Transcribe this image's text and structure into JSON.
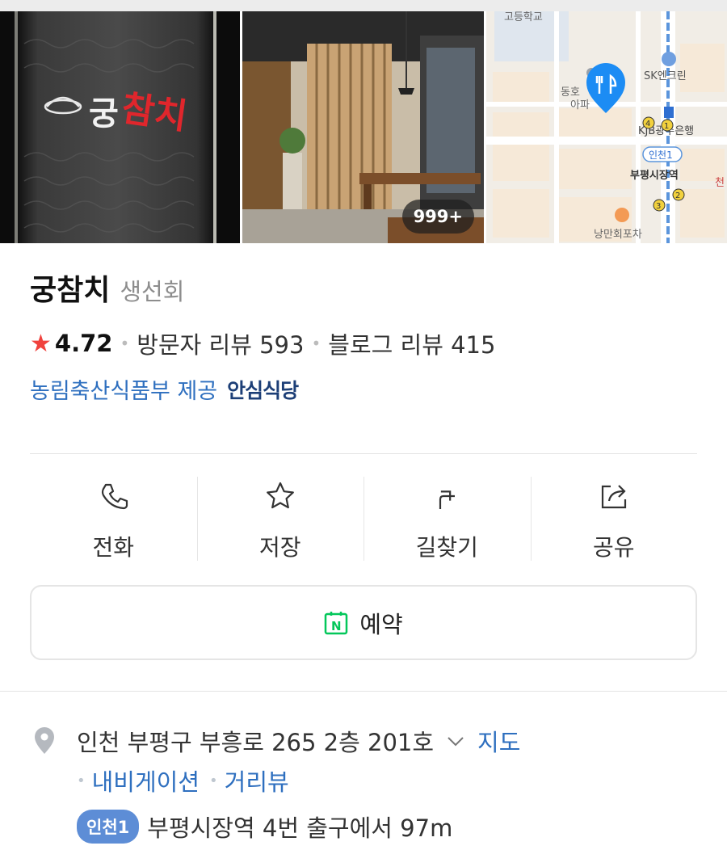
{
  "photos": {
    "count_badge": "999+",
    "logo_text": "궁참치"
  },
  "map": {
    "labels": {
      "school": "고등학교",
      "apartment": "동호",
      "apartment_suffix": "아파",
      "cleaner": "SK엔크린",
      "bank": "KJB광주은행",
      "station_badge": "인천1",
      "station_name": "부평시장역",
      "restaurant": "낭만회포차",
      "edge_label": "천"
    },
    "exit_numbers": [
      "4",
      "1",
      "2",
      "3"
    ]
  },
  "place": {
    "name": "궁참치",
    "category": "생선회",
    "rating": "4.72",
    "visitor_reviews": "방문자 리뷰 593",
    "blog_reviews": "블로그 리뷰 415",
    "provider": "농림축산식품부 제공",
    "safe_badge": "안심식당"
  },
  "actions": [
    {
      "label": "전화",
      "icon": "phone-icon"
    },
    {
      "label": "저장",
      "icon": "star-outline-icon"
    },
    {
      "label": "길찾기",
      "icon": "directions-icon"
    },
    {
      "label": "공유",
      "icon": "share-icon"
    }
  ],
  "reserve": {
    "label": "예약",
    "icon": "naver-booking-icon",
    "icon_text": "N"
  },
  "address": {
    "text": "인천 부평구 부흥로 265 2층 201호",
    "map_link": "지도",
    "navigation_link": "내비게이션",
    "street_view_link": "거리뷰",
    "line_badge": "인천1",
    "station_distance": "부평시장역 4번 출구에서 97m"
  },
  "colors": {
    "accent_blue": "#2e6fbf",
    "star_red": "#f0423d",
    "naver_green": "#03c75a",
    "map_pin": "#1c8cf4",
    "line_badge": "#5d8dd6"
  }
}
